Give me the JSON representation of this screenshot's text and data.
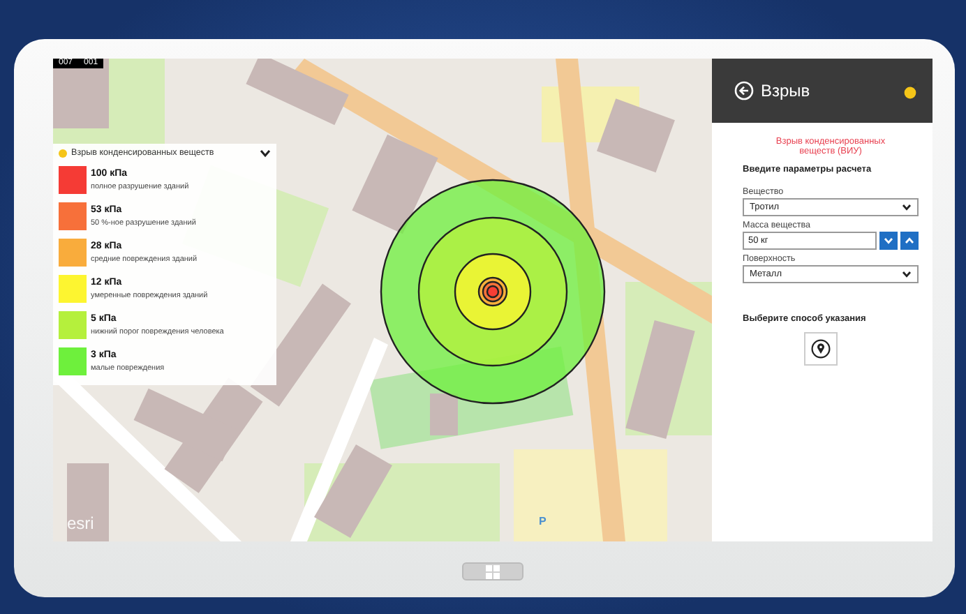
{
  "map": {
    "corner_labels": [
      "007",
      "001"
    ],
    "attribution": "esri",
    "parking_label": "P",
    "legend": {
      "title": "Взрыв конденсированных веществ",
      "expanded": true,
      "items": [
        {
          "value": "100 кПа",
          "description": "полное разрушение зданий",
          "color": "#f53b35"
        },
        {
          "value": "53 кПа",
          "description": "50 %-ное разрушение зданий",
          "color": "#f7703a"
        },
        {
          "value": "28 кПа",
          "description": "средние повреждения зданий",
          "color": "#f9ac3c"
        },
        {
          "value": "12 кПа",
          "description": "умеренные повреждения зданий",
          "color": "#fdf530"
        },
        {
          "value": "5 кПа",
          "description": "нижний порог повреждения человека",
          "color": "#b5f03c"
        },
        {
          "value": "3 кПа",
          "description": "малые повреждения",
          "color": "#6ef03c"
        }
      ]
    }
  },
  "panel": {
    "title": "Взрыв",
    "subtitle": "Взрыв конденсированных веществ (ВИУ)",
    "heading": "Введите параметры расчета",
    "fields": [
      {
        "kind": "dropdown",
        "label": "Вещество",
        "value": "Тротил"
      },
      {
        "kind": "stepper",
        "label": "Масса вещества",
        "value": "50 кг"
      },
      {
        "kind": "dropdown",
        "label": "Поверхность",
        "value": "Металл"
      }
    ],
    "method_heading": "Выберите способ указания"
  }
}
